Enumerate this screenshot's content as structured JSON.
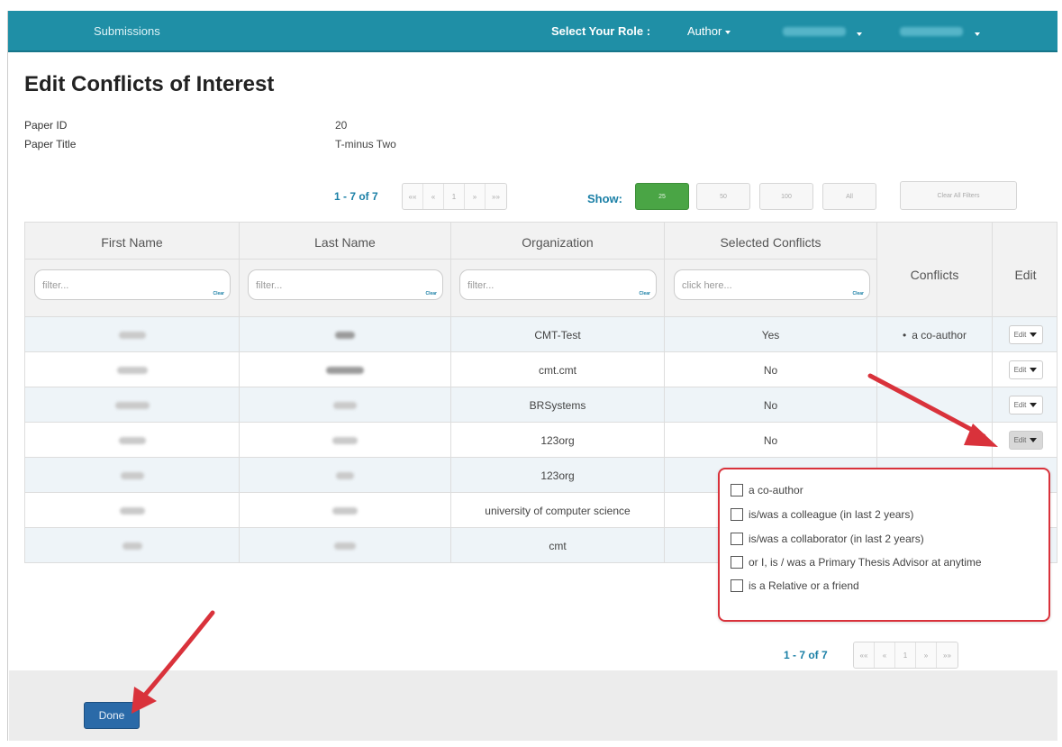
{
  "nav": {
    "submissions": "Submissions",
    "role_label": "Select Your Role :",
    "role_value": "Author"
  },
  "page_title": "Edit Conflicts of Interest",
  "paper": {
    "id_label": "Paper ID",
    "id_value": "20",
    "title_label": "Paper Title",
    "title_value": "T-minus Two"
  },
  "pager": {
    "count": "1 - 7 of 7",
    "first": "«« ",
    "prev": "«",
    "page": "1",
    "next": "»",
    "last": "»»",
    "show_label": "Show:",
    "sizes": [
      "25",
      "50",
      "100",
      "All"
    ],
    "clear_filters": "Clear All Filters"
  },
  "table": {
    "headers": {
      "first_name": "First Name",
      "last_name": "Last Name",
      "organization": "Organization",
      "selected_conflicts": "Selected Conflicts",
      "conflicts": "Conflicts",
      "edit": "Edit"
    },
    "filters": {
      "first_name": "filter...",
      "last_name": "filter...",
      "organization": "filter...",
      "selected_conflicts": "click here...",
      "clear": "Clear"
    },
    "rows": [
      {
        "organization": "CMT-Test",
        "selected": "Yes",
        "conflict": "a co-author",
        "edit": "Edit"
      },
      {
        "organization": "cmt.cmt",
        "selected": "No",
        "conflict": "",
        "edit": "Edit"
      },
      {
        "organization": "BRSystems",
        "selected": "No",
        "conflict": "",
        "edit": "Edit"
      },
      {
        "organization": "123org",
        "selected": "No",
        "conflict": "",
        "edit": "Edit"
      },
      {
        "organization": "123org",
        "selected": "",
        "conflict": "",
        "edit": ""
      },
      {
        "organization": "university of computer science",
        "selected": "",
        "conflict": "",
        "edit": ""
      },
      {
        "organization": "cmt",
        "selected": "",
        "conflict": "",
        "edit": ""
      }
    ]
  },
  "conflict_options": [
    "a co-author",
    "is/was a colleague (in last 2 years)",
    "is/was a collaborator (in last 2 years)",
    "or I, is / was a Primary Thesis Advisor at anytime",
    "is a Relative or a friend"
  ],
  "done_label": "Done",
  "colors": {
    "navbar": "#1f8fa6",
    "accent_link": "#1a7fa6",
    "show_active": "#4aa545",
    "done_button": "#2a6aa8",
    "annotation_red": "#d9323b"
  }
}
